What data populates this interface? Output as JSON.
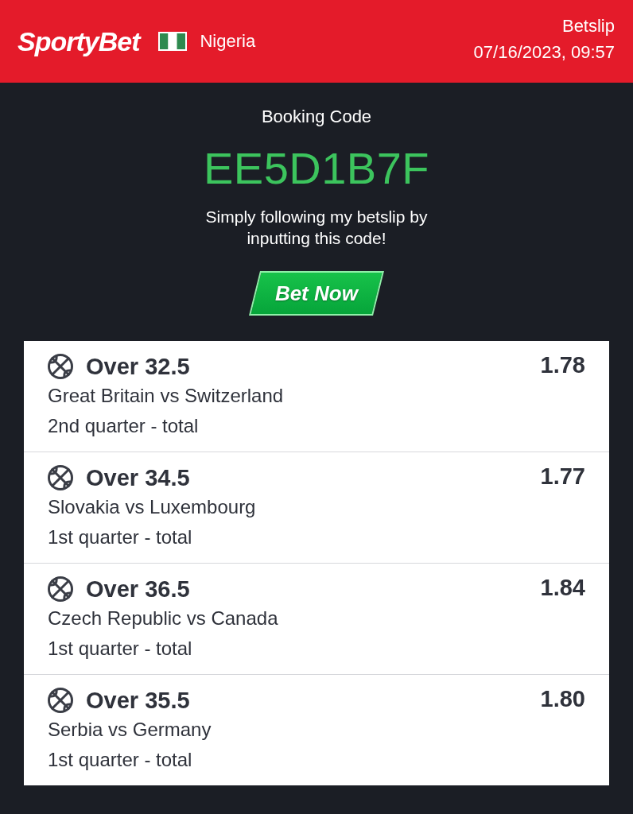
{
  "header": {
    "logo": "SportyBet",
    "country": "Nigeria",
    "title": "Betslip",
    "datetime": "07/16/2023, 09:57"
  },
  "booking": {
    "label": "Booking Code",
    "code": "EE5D1B7F",
    "message": "Simply following my betslip by inputting this code!",
    "button": "Bet Now"
  },
  "bets": [
    {
      "selection": "Over 32.5",
      "odds": "1.78",
      "match": "Great Britain vs Switzerland",
      "market": "2nd quarter - total"
    },
    {
      "selection": "Over 34.5",
      "odds": "1.77",
      "match": "Slovakia vs Luxembourg",
      "market": "1st quarter - total"
    },
    {
      "selection": "Over 36.5",
      "odds": "1.84",
      "match": "Czech Republic vs Canada",
      "market": "1st quarter - total"
    },
    {
      "selection": "Over 35.5",
      "odds": "1.80",
      "match": "Serbia vs Germany",
      "market": "1st quarter - total"
    }
  ]
}
